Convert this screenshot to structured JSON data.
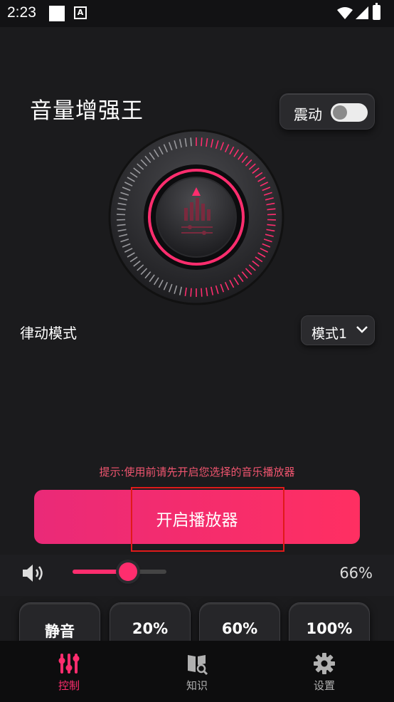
{
  "status_bar": {
    "time": "2:23"
  },
  "header": {
    "title": "音量增强王",
    "vibrate_label": "震动",
    "vibrate_on": false
  },
  "dial": {
    "icon": "equalizer-icon"
  },
  "mode": {
    "label": "律动模式",
    "selected": "模式1"
  },
  "hint": "提示:使用前请先开启您选择的音乐播放器",
  "play_button": "开启播放器",
  "volume": {
    "percent_text": "66%",
    "level": 0.66
  },
  "quick_buttons": [
    "静音",
    "20%",
    "60%",
    "100%"
  ],
  "tabs": [
    {
      "label": "控制",
      "icon": "sliders-icon",
      "active": true
    },
    {
      "label": "知识",
      "icon": "book-icon",
      "active": false
    },
    {
      "label": "设置",
      "icon": "gear-icon",
      "active": false
    }
  ],
  "colors": {
    "accent": "#ff2d6e",
    "hint": "#f0556f",
    "tab_inactive": "#b0b0b0"
  }
}
